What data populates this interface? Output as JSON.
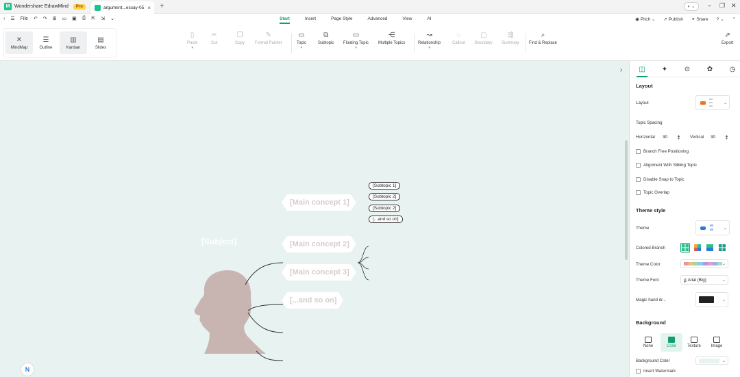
{
  "titlebar": {
    "app_name": "Wondershare EdrawMind",
    "pro_badge": "Pro",
    "doc_tab": "argument...essay-05",
    "new_tab_icon": "plus-icon"
  },
  "menubar": {
    "file_label": "File",
    "tabs": [
      {
        "label": "Start",
        "active": true
      },
      {
        "label": "Insert",
        "active": false
      },
      {
        "label": "Page Style",
        "active": false
      },
      {
        "label": "Advanced",
        "active": false
      },
      {
        "label": "View",
        "active": false
      },
      {
        "label": "AI",
        "active": false
      }
    ],
    "right": {
      "pitch": "Pitch",
      "publish": "Publish",
      "share": "Share"
    }
  },
  "ribbon": {
    "view_modes": [
      {
        "label": "MindMap",
        "icon": "mindmap-icon",
        "active": true
      },
      {
        "label": "Outline",
        "icon": "outline-icon",
        "active": false
      },
      {
        "label": "Kanban",
        "icon": "kanban-icon",
        "active": true
      },
      {
        "label": "Slides",
        "icon": "slides-icon",
        "active": false
      }
    ],
    "tools": [
      {
        "label": "Paste",
        "icon": "paste-icon",
        "disabled": true,
        "caret": true
      },
      {
        "label": "Cut",
        "icon": "cut-icon",
        "disabled": true,
        "caret": false
      },
      {
        "label": "Copy",
        "icon": "copy-icon",
        "disabled": true,
        "caret": false
      },
      {
        "label": "Format Painter",
        "icon": "format-painter-icon",
        "disabled": true,
        "caret": false
      },
      {
        "label": "Topic",
        "icon": "topic-icon",
        "disabled": false,
        "caret": true
      },
      {
        "label": "Subtopic",
        "icon": "subtopic-icon",
        "disabled": false,
        "caret": false
      },
      {
        "label": "Floating Topic",
        "icon": "floating-topic-icon",
        "disabled": false,
        "caret": true
      },
      {
        "label": "Multiple Topics",
        "icon": "multiple-topics-icon",
        "disabled": false,
        "caret": false
      },
      {
        "label": "Relationship",
        "icon": "relationship-icon",
        "disabled": false,
        "caret": true
      },
      {
        "label": "Callout",
        "icon": "callout-icon",
        "disabled": true,
        "caret": false
      },
      {
        "label": "Boundary",
        "icon": "boundary-icon",
        "disabled": true,
        "caret": false
      },
      {
        "label": "Summary",
        "icon": "summary-icon",
        "disabled": true,
        "caret": false
      },
      {
        "label": "Find & Replace",
        "icon": "find-replace-icon",
        "disabled": false,
        "caret": false
      },
      {
        "label": "Export",
        "icon": "export-icon",
        "disabled": false,
        "caret": false
      }
    ]
  },
  "mindmap": {
    "subject": "[Subject]",
    "main_concepts": [
      "[Main concept 1]",
      "[Main concept 2]",
      "[Main concept 3]",
      "[...and so on]"
    ],
    "subtopics": [
      "[Subtopic 1]",
      "[Subtopic 2]",
      "[Subtopic 2]",
      "[...and so on]"
    ],
    "colors": {
      "canvas_bg": "#e8f2f1",
      "head_fill": "#c8b4b0",
      "node_text": "#d8cccb",
      "line": "#2d3a3a"
    }
  },
  "panel": {
    "tabs": [
      "layout-tab-icon",
      "style-tab-icon",
      "location-tab-icon",
      "badge-tab-icon",
      "history-tab-icon"
    ],
    "layout_section": "Layout",
    "layout_label": "Layout",
    "topic_spacing": "Topic Spacing",
    "horizontal_label": "Horizontal",
    "horizontal_value": "30",
    "vertical_label": "Vertical",
    "vertical_value": "30",
    "checkboxes": [
      "Branch Free Positioning",
      "Alignment With Sibling Topic",
      "Disable Snap to Topic",
      "Topic Overlap"
    ],
    "theme_section": "Theme style",
    "theme_label": "Theme",
    "colored_branch_label": "Colored Branch",
    "theme_color_label": "Theme Color",
    "theme_font_label": "Theme Font",
    "theme_font_value": "Arial (Big)",
    "magic_label": "Magic hand dr...",
    "background_section": "Background",
    "bg_options": [
      {
        "label": "None",
        "active": false
      },
      {
        "label": "Color",
        "active": true
      },
      {
        "label": "Texture",
        "active": false
      },
      {
        "label": "Image",
        "active": false
      }
    ],
    "bg_color_label": "Background Color",
    "watermark_label": "Insert Watermark",
    "accent_color": "#0f9f6e"
  }
}
